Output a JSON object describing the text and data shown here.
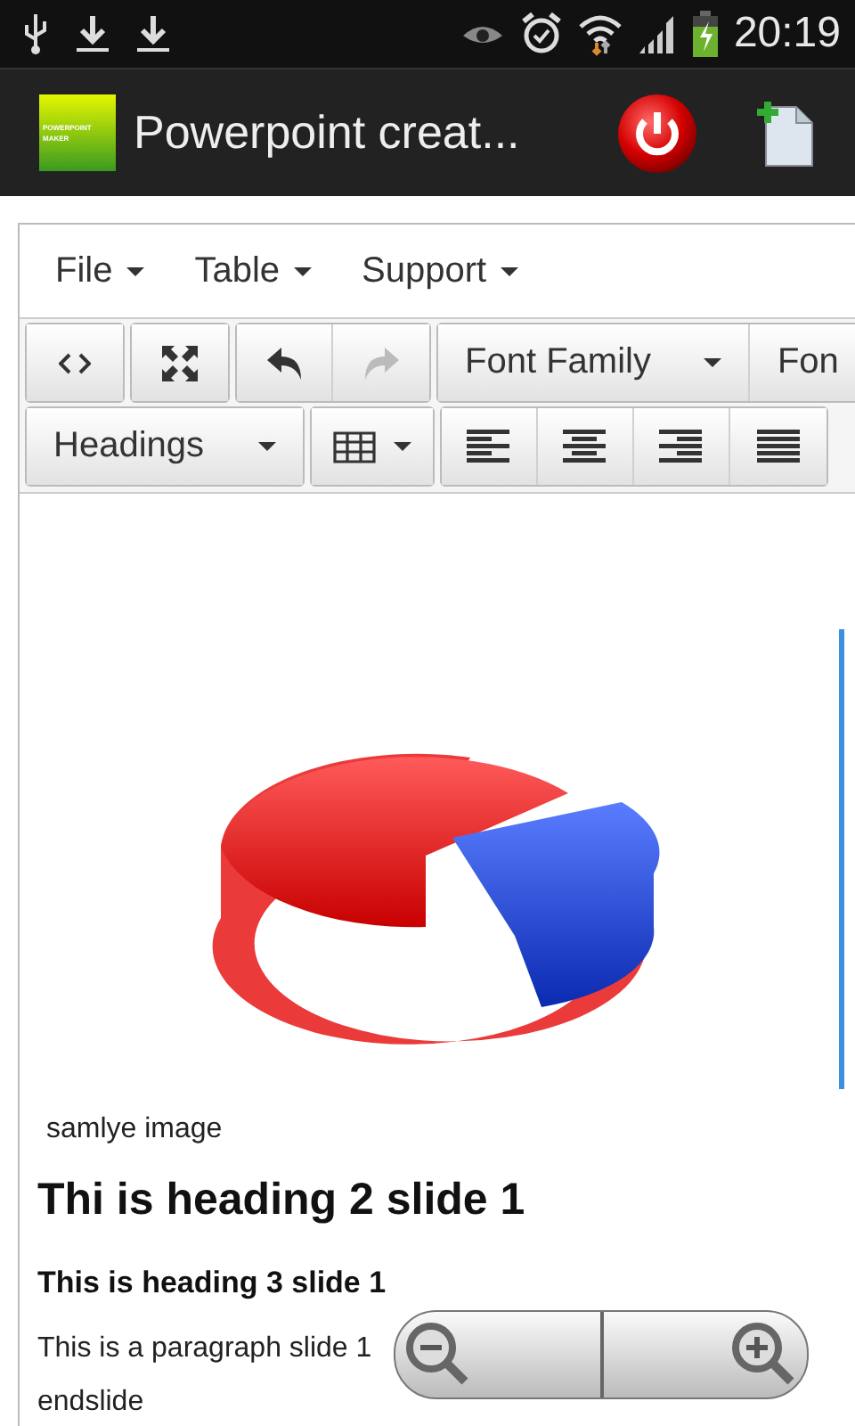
{
  "status_bar": {
    "time": "20:19"
  },
  "app_bar": {
    "logo_text": [
      "POWERPOINT",
      "MAKER"
    ],
    "title": "Powerpoint creat..."
  },
  "menu": [
    {
      "label": "File"
    },
    {
      "label": "Table"
    },
    {
      "label": "Support"
    }
  ],
  "toolbar_rows": [
    [
      {
        "items": [
          {
            "kind": "code",
            "disabled": false
          }
        ]
      },
      {
        "items": [
          {
            "kind": "fullscreen",
            "disabled": false
          }
        ]
      },
      {
        "items": [
          {
            "kind": "undo",
            "disabled": false
          },
          {
            "kind": "redo",
            "disabled": true
          }
        ]
      },
      {
        "items": [
          {
            "kind": "select",
            "label": "Font Family",
            "disabled": false
          },
          {
            "kind": "select",
            "label": "Fon",
            "disabled": false
          }
        ]
      }
    ],
    [
      {
        "items": [
          {
            "kind": "select",
            "label": "Headings",
            "disabled": false
          }
        ]
      },
      {
        "items": [
          {
            "kind": "table",
            "disabled": false
          }
        ]
      },
      {
        "items": [
          {
            "kind": "align-left",
            "disabled": false
          },
          {
            "kind": "align-center",
            "disabled": false
          },
          {
            "kind": "align-right",
            "disabled": false
          },
          {
            "kind": "justify",
            "disabled": false
          }
        ]
      }
    ]
  ],
  "content": {
    "image_caption": "samlye image",
    "heading2": "Thi is heading 2 slide 1",
    "heading3": "This is heading 3 slide 1",
    "paragraph": "This is a paragraph slide 1",
    "end_text": "endslide"
  }
}
